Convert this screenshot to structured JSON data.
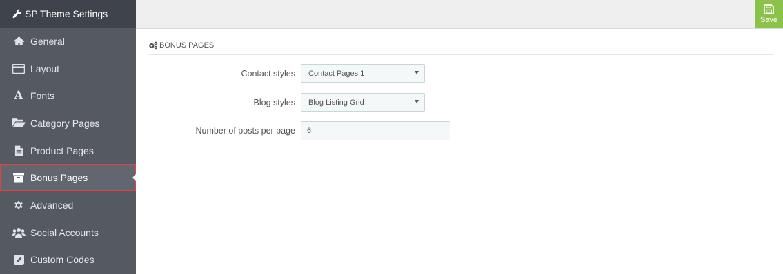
{
  "app": {
    "title": "SP Theme Settings"
  },
  "toolbar": {
    "save_label": "Save"
  },
  "sidebar": {
    "items": [
      {
        "label": "General",
        "icon": "home-icon"
      },
      {
        "label": "Layout",
        "icon": "credit-card-icon"
      },
      {
        "label": "Fonts",
        "icon": "font-icon"
      },
      {
        "label": "Category Pages",
        "icon": "folder-open-icon"
      },
      {
        "label": "Product Pages",
        "icon": "file-text-icon"
      },
      {
        "label": "Bonus Pages",
        "icon": "archive-icon",
        "active": true
      },
      {
        "label": "Advanced",
        "icon": "gear-icon"
      },
      {
        "label": "Social Accounts",
        "icon": "users-icon"
      },
      {
        "label": "Custom Codes",
        "icon": "pencil-square-icon"
      }
    ]
  },
  "panel": {
    "heading": "BONUS PAGES",
    "fields": {
      "contact_styles": {
        "label": "Contact styles",
        "value": "Contact Pages 1"
      },
      "blog_styles": {
        "label": "Blog styles",
        "value": "Blog Listing Grid"
      },
      "posts_per_page": {
        "label": "Number of posts per page",
        "value": "6"
      }
    }
  },
  "colors": {
    "sidebar_bg": "#545962",
    "sidebar_header_bg": "#3f444c",
    "active_border": "#e2433f",
    "save_green": "#8bc34a"
  }
}
